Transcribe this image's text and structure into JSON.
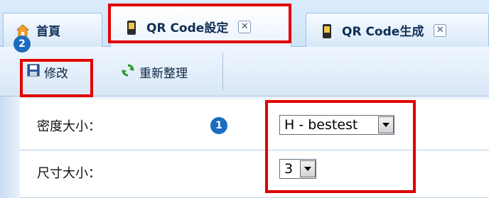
{
  "tabs": {
    "home": "首頁",
    "qr_settings": "QR Code設定",
    "qr_generate": "QR Code生成",
    "close_glyph": "✕"
  },
  "toolbar": {
    "edit_label": "修改",
    "refresh_label": "重新整理"
  },
  "form": {
    "density": {
      "label": "密度大小：",
      "value": "H - bestest"
    },
    "size": {
      "label": "尺寸大小：",
      "value": "3"
    }
  },
  "badges": {
    "one": "1",
    "two": "2"
  },
  "colors": {
    "highlight": "#e00000",
    "badge": "#1a6cc0"
  }
}
